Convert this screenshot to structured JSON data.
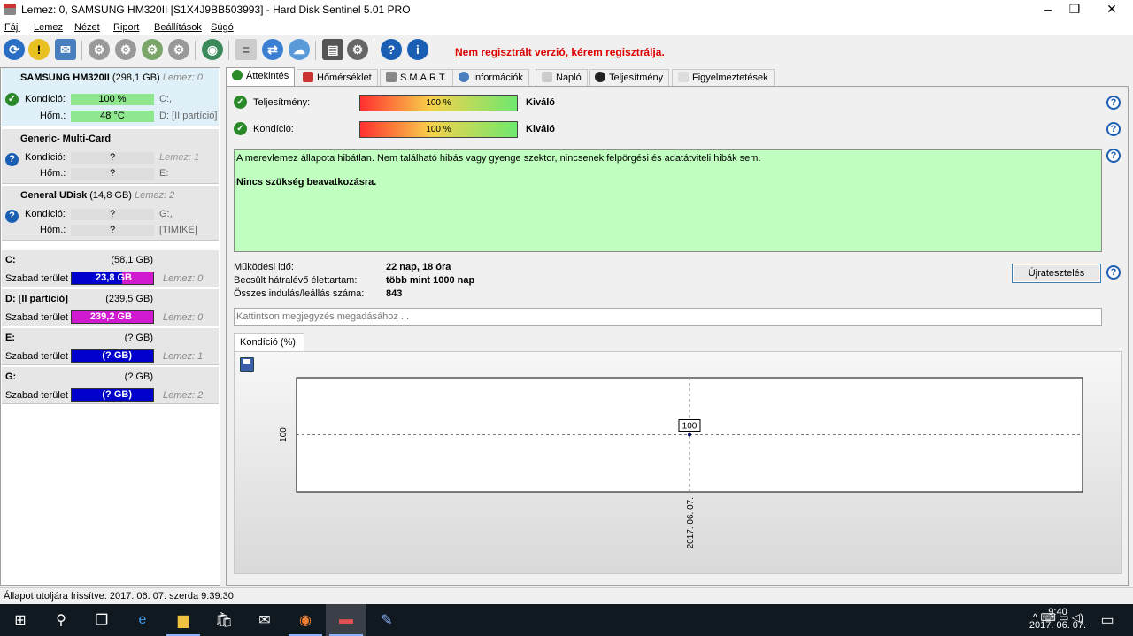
{
  "window": {
    "title": "Lemez: 0, SAMSUNG HM320II [S1X4J9BB503993]  -  Hard Disk Sentinel 5.01 PRO",
    "minimize": "–",
    "maximize": "❐",
    "close": "✕"
  },
  "menu": [
    "Fájl",
    "Lemez",
    "Nézet",
    "Riport",
    "Beállítások",
    "Súgó"
  ],
  "toolbar": {
    "unregistered": "Nem regisztrált verzió, kérem regisztrálja."
  },
  "disks": [
    {
      "name": "SAMSUNG HM320II",
      "size": "(298,1 GB)",
      "index": "Lemez: 0",
      "cond_label": "Kondíció:",
      "cond_value": "100 %",
      "temp_label": "Hőm.:",
      "temp_value": "48 °C",
      "drive1": "C:,",
      "drive2": "D: [II partíció]",
      "status_icon": "check-icon"
    },
    {
      "name": "Generic- Multi-Card",
      "size": "",
      "index": "",
      "cond_label": "Kondíció:",
      "cond_value": "?",
      "temp_label": "Hőm.:",
      "temp_value": "?",
      "drive1": "Lemez: 1",
      "drive2": "E:",
      "status_icon": "question-icon"
    },
    {
      "name": "General UDisk",
      "size": "(14,8 GB)",
      "index": "Lemez: 2",
      "cond_label": "Kondíció:",
      "cond_value": "?",
      "temp_label": "Hőm.:",
      "temp_value": "?",
      "drive1": "G:,",
      "drive2": "[TIMIKE]",
      "status_icon": "question-icon"
    }
  ],
  "partitions": [
    {
      "name": "C:",
      "size": "(58,1 GB)",
      "free_label": "Szabad terület",
      "free": "23,8 GB",
      "disk": "Lemez: 0"
    },
    {
      "name": "D: [II partíció]",
      "size": "(239,5 GB)",
      "free_label": "Szabad terület",
      "free": "239,2 GB",
      "disk": "Lemez: 0"
    },
    {
      "name": "E:",
      "size": "(? GB)",
      "free_label": "Szabad terület",
      "free": "(? GB)",
      "disk": "Lemez: 1"
    },
    {
      "name": "G:",
      "size": "(? GB)",
      "free_label": "Szabad terület",
      "free": "(? GB)",
      "disk": "Lemez: 2"
    }
  ],
  "tabs": [
    "Áttekintés",
    "Hőmérséklet",
    "S.M.A.R.T.",
    "Információk",
    "Napló",
    "Teljesítmény",
    "Figyelmeztetések"
  ],
  "overview": {
    "perf_label": "Teljesítmény:",
    "perf_value": "100 %",
    "perf_rating": "Kiváló",
    "cond_label": "Kondíció:",
    "cond_value": "100 %",
    "cond_rating": "Kiváló",
    "status_text": "A merevlemez állapota hibátlan. Nem található hibás vagy gyenge szektor, nincsenek felpörgési és adatátviteli hibák sem.",
    "status_action": "Nincs szükség beavatkozásra.",
    "uptime_label": "Működési idő:",
    "uptime_value": "22 nap, 18 óra",
    "lifetime_label": "Becsült hátralévő élettartam:",
    "lifetime_value": "több mint 1000 nap",
    "starts_label": "Összes indulás/leállás száma:",
    "starts_value": "843",
    "reset_button": "Újratesztelés",
    "note_placeholder": "Kattintson megjegyzés megadásához ...",
    "chart_tab": "Kondíció  (%)"
  },
  "chart_data": {
    "type": "line",
    "x": [
      "2017. 06. 07."
    ],
    "series": [
      {
        "values": [
          100
        ]
      }
    ],
    "ylabel": "",
    "ytick": "100",
    "point_label": "100"
  },
  "statusbar": {
    "text": "Állapot utoljára frissítve: 2017. 06. 07. szerda 9:39:30"
  },
  "taskbar": {
    "time": "9:40",
    "date": "2017. 06. 07.",
    "tray": "^  ⌨  ▭  ◁)"
  },
  "colors": {
    "unregistered": "#dd0000",
    "status_bg": "#c0ffc0",
    "ok": "#2a8a2a",
    "question": "#1a5fb4"
  }
}
